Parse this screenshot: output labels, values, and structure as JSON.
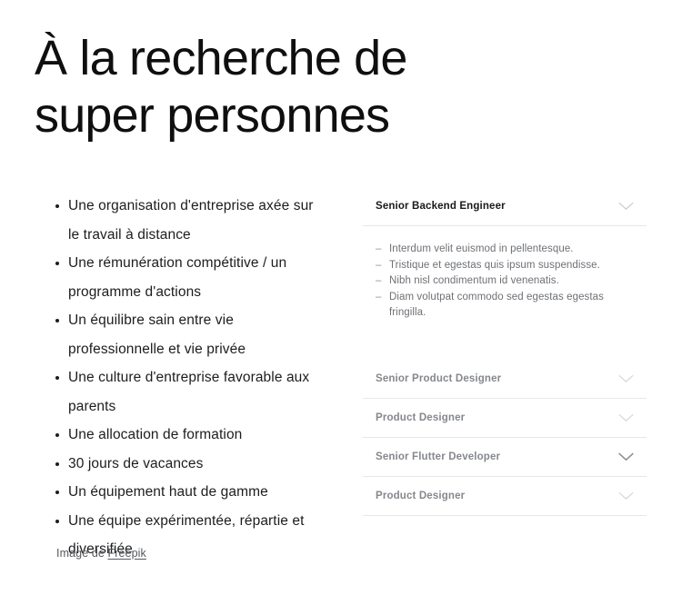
{
  "hero": {
    "heading": "À la recherche de\nsuper personnes"
  },
  "benefits": {
    "items": [
      "Une organisation d'entreprise axée sur le travail à distance",
      "Une rémunération compétitive / un programme d'actions",
      "Un équilibre sain entre vie professionnelle et vie privée",
      "Une culture d'entreprise favorable aux parents",
      "Une allocation de formation",
      "30 jours de vacances",
      "Un équipement haut de gamme",
      "Une équipe expérimentée, répartie et diversifiée"
    ]
  },
  "credit": {
    "prefix": "Image de ",
    "link_label": "Freepik"
  },
  "accordion": {
    "items": [
      {
        "title": "Senior Backend Engineer",
        "state": "open",
        "icon": "chevron-down-icon",
        "details": [
          "Interdum velit euismod in pellentesque.",
          "Tristique et egestas quis ipsum suspendisse.",
          "Nibh nisl condimentum id venenatis.",
          "Diam volutpat commodo sed egestas egestas fringilla."
        ]
      },
      {
        "title": "Senior Product Designer",
        "state": "collapsed",
        "icon": "chevron-down-icon",
        "details": []
      },
      {
        "title": "Product Designer",
        "state": "collapsed",
        "icon": "chevron-down-icon",
        "details": []
      },
      {
        "title": "Senior Flutter Developer",
        "state": "collapsed",
        "icon": "chevron-down-icon",
        "details": []
      },
      {
        "title": "Product Designer",
        "state": "collapsed",
        "icon": "chevron-down-icon",
        "details": []
      }
    ]
  },
  "colors": {
    "background": "#ffffff",
    "heading_text": "#0f0f0f",
    "body_text": "#1d1d1d",
    "muted_text": "#85888d",
    "detail_text": "#6d7075",
    "divider": "#e6e7e9"
  }
}
